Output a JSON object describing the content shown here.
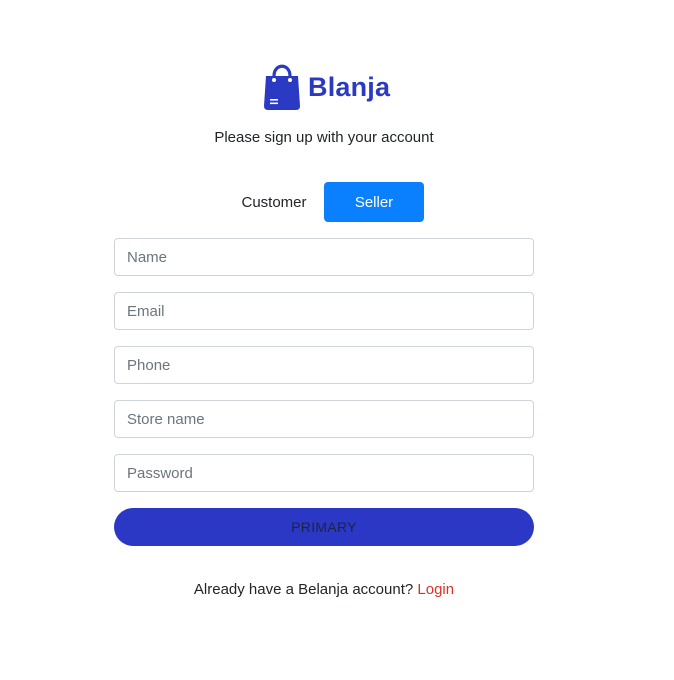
{
  "brand": {
    "name": "Blanja",
    "icon": "shopping-bag-icon",
    "color": "#2a3ac2"
  },
  "subtitle": "Please sign up with your account",
  "roles": {
    "customer_label": "Customer",
    "seller_label": "Seller",
    "selected": "Seller",
    "selected_color": "#0a80ff"
  },
  "form": {
    "name_placeholder": "Name",
    "email_placeholder": "Email",
    "phone_placeholder": "Phone",
    "store_placeholder": "Store name",
    "password_placeholder": "Password",
    "submit_label": "PRIMARY",
    "submit_color": "#2b38c6"
  },
  "footer": {
    "prompt": "Already have a Belanja account?",
    "login_label": "Login",
    "login_color": "#db3022"
  }
}
